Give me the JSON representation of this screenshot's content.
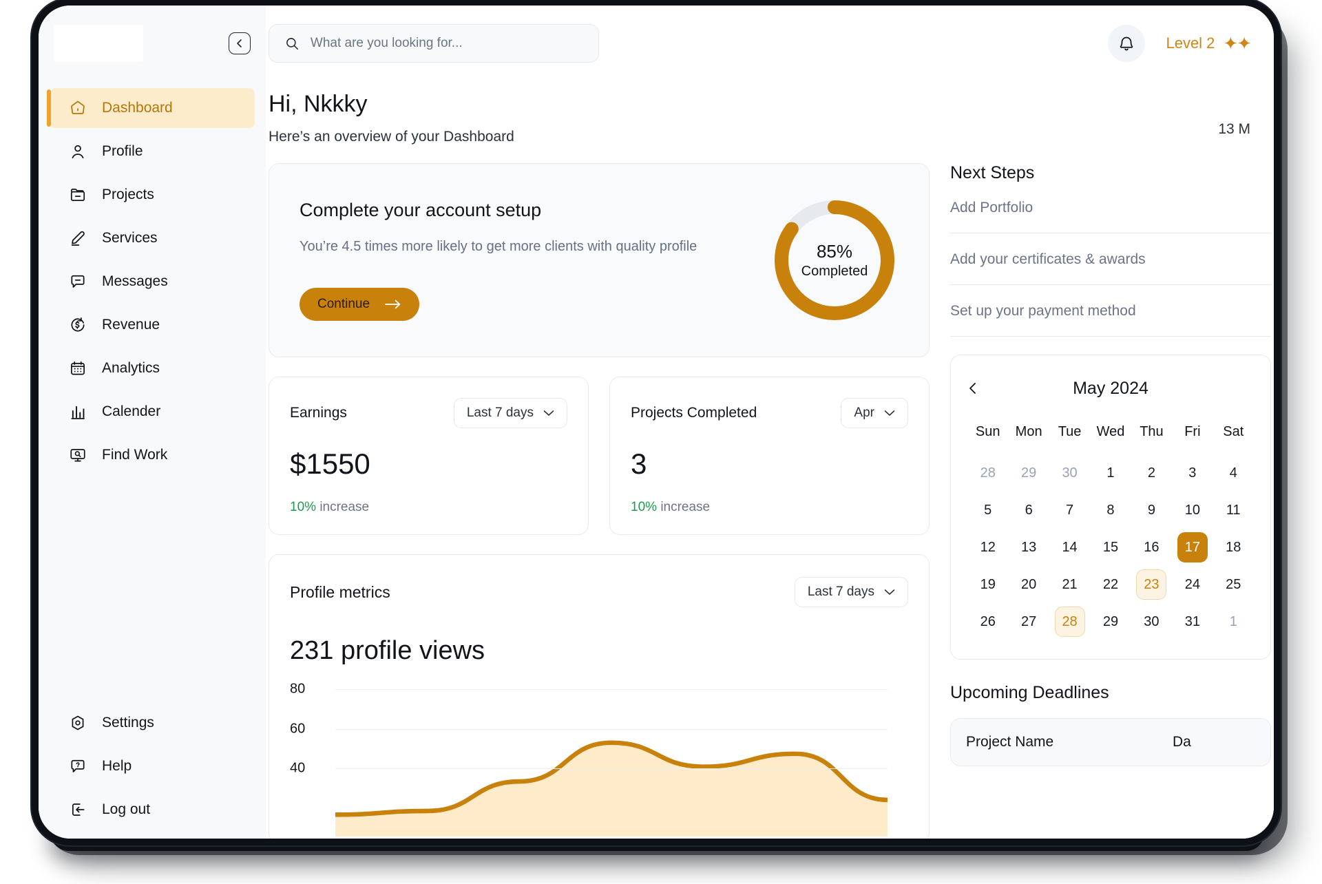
{
  "brand": {
    "logo_name": "app-logo"
  },
  "sidebar": {
    "collapse_icon": "chevron-left-icon",
    "items": [
      {
        "label": "Dashboard",
        "icon": "home-icon",
        "active": true
      },
      {
        "label": "Profile",
        "icon": "user-icon",
        "active": false
      },
      {
        "label": "Projects",
        "icon": "folder-icon",
        "active": false
      },
      {
        "label": "Services",
        "icon": "pencil-icon",
        "active": false
      },
      {
        "label": "Messages",
        "icon": "chat-bubble-icon",
        "active": false
      },
      {
        "label": "Revenue",
        "icon": "dollar-refresh-icon",
        "active": false
      },
      {
        "label": "Analytics",
        "icon": "calendar-grid-icon",
        "active": false
      },
      {
        "label": "Calender",
        "icon": "bar-chart-icon",
        "active": false
      },
      {
        "label": "Find Work",
        "icon": "monitor-search-icon",
        "active": false
      }
    ],
    "bottom_items": [
      {
        "label": "Settings",
        "icon": "gear-icon"
      },
      {
        "label": "Help",
        "icon": "question-bubble-icon"
      },
      {
        "label": "Log out",
        "icon": "logout-icon"
      }
    ]
  },
  "topbar": {
    "search": {
      "placeholder": "What are you looking for...",
      "value": "",
      "icon": "search-icon"
    },
    "bell_icon": "bell-icon",
    "level_label": "Level 2",
    "sparkles": "✦✦"
  },
  "greeting": {
    "title": "Hi, Nkkky",
    "subtitle": "Here’s an overview of your Dashboard",
    "date": "13 M"
  },
  "setup_card": {
    "title": "Complete your account setup",
    "description": "You’re 4.5 times more likely to get more clients with quality profile",
    "button_label": "Continue",
    "button_icon": "arrow-right-icon",
    "progress_percent": "85%",
    "progress_caption": "Completed",
    "progress_value": 85,
    "ring_color": "#c8810a",
    "ring_track_color": "#e6e9ee"
  },
  "stats": [
    {
      "label": "Earnings",
      "range": "Last 7 days",
      "value": "$1550",
      "delta": "10%",
      "delta_text": "increase",
      "delta_color": "#1d9a4f"
    },
    {
      "label": "Projects Completed",
      "range": "Apr",
      "value": "3",
      "delta": "10%",
      "delta_text": "increase",
      "delta_color": "#1d9a4f"
    }
  ],
  "metrics": {
    "title": "Profile metrics",
    "range": "Last 7 days",
    "headline": "231 profile views"
  },
  "chart_data": {
    "type": "area",
    "title": "231 profile views",
    "xlabel": "",
    "ylabel": "",
    "ylim": [
      0,
      80
    ],
    "yticks": [
      80,
      60,
      40
    ],
    "grid": true,
    "legend": null,
    "line_color": "#c8810a",
    "fill_color": "#fdebc9",
    "x": [
      0,
      1,
      2,
      3,
      4,
      5,
      6
    ],
    "values": [
      12,
      14,
      30,
      51,
      38,
      45,
      20
    ]
  },
  "next_steps": {
    "title": "Next Steps",
    "items": [
      "Add Portfolio",
      "Add your certificates & awards",
      "Set up your payment method"
    ]
  },
  "calendar": {
    "prev_icon": "chevron-left-icon",
    "month_label": "May 2024",
    "day_names": [
      "Sun",
      "Mon",
      "Tue",
      "Wed",
      "Thu",
      "Fri",
      "Sat"
    ],
    "weeks": [
      [
        {
          "d": "28",
          "state": "muted"
        },
        {
          "d": "29",
          "state": "muted"
        },
        {
          "d": "30",
          "state": "muted"
        },
        {
          "d": "1",
          "state": ""
        },
        {
          "d": "2",
          "state": ""
        },
        {
          "d": "3",
          "state": ""
        },
        {
          "d": "4",
          "state": ""
        }
      ],
      [
        {
          "d": "5",
          "state": ""
        },
        {
          "d": "6",
          "state": ""
        },
        {
          "d": "7",
          "state": ""
        },
        {
          "d": "8",
          "state": ""
        },
        {
          "d": "9",
          "state": ""
        },
        {
          "d": "10",
          "state": ""
        },
        {
          "d": "11",
          "state": ""
        }
      ],
      [
        {
          "d": "12",
          "state": ""
        },
        {
          "d": "13",
          "state": ""
        },
        {
          "d": "14",
          "state": ""
        },
        {
          "d": "15",
          "state": ""
        },
        {
          "d": "16",
          "state": ""
        },
        {
          "d": "17",
          "state": "selected"
        },
        {
          "d": "18",
          "state": ""
        }
      ],
      [
        {
          "d": "19",
          "state": ""
        },
        {
          "d": "20",
          "state": ""
        },
        {
          "d": "21",
          "state": ""
        },
        {
          "d": "22",
          "state": ""
        },
        {
          "d": "23",
          "state": "marked"
        },
        {
          "d": "24",
          "state": ""
        },
        {
          "d": "25",
          "state": ""
        }
      ],
      [
        {
          "d": "26",
          "state": ""
        },
        {
          "d": "27",
          "state": ""
        },
        {
          "d": "28",
          "state": "marked"
        },
        {
          "d": "29",
          "state": ""
        },
        {
          "d": "30",
          "state": ""
        },
        {
          "d": "31",
          "state": ""
        },
        {
          "d": "1",
          "state": "muted"
        }
      ]
    ]
  },
  "deadlines": {
    "title": "Upcoming Deadlines",
    "columns": [
      "Project Name",
      "Da"
    ]
  },
  "colors": {
    "accent": "#c8810a",
    "accent_light": "#fdeccb",
    "accent_bar": "#f0a32a",
    "surface": "#f7f9fb",
    "text": "#11151b",
    "muted": "#6b7486",
    "success": "#1d9a4f"
  }
}
